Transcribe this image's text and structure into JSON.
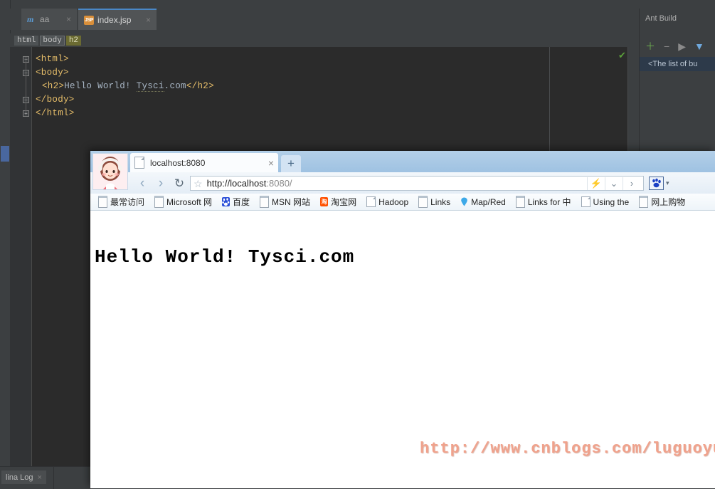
{
  "ide": {
    "tabs": [
      {
        "label": "aa",
        "icon": "maven-icon",
        "active": false,
        "close": "×"
      },
      {
        "label": "index.jsp",
        "icon": "jsp-file-icon",
        "active": true,
        "close": "×"
      }
    ],
    "breadcrumb": [
      "html",
      "body",
      "h2"
    ],
    "code_lines": [
      {
        "indent": 0,
        "fold": "minus",
        "html": "<span class='tag'>&lt;html&gt;</span>"
      },
      {
        "indent": 0,
        "fold": "minus",
        "html": "<span class='tag'>&lt;body&gt;</span>"
      },
      {
        "indent": 1,
        "fold": "none",
        "html": "<span class='tag'>&lt;h2&gt;</span><span class='txt'>Hello World! </span><span class='txt spell'>Tysci</span><span class='txt'>.com</span><span class='tag'>&lt;/h2&gt;</span>"
      },
      {
        "indent": 0,
        "fold": "plus",
        "html": "<span class='tag'>&lt;/body&gt;</span>"
      },
      {
        "indent": 0,
        "fold": "plus",
        "html": "<span class='tag'>&lt;/html&gt;</span>"
      }
    ],
    "code_plain": [
      "<html>",
      "<body>",
      "<h2>Hello World! Tysci.com</h2>",
      "</body>",
      "</html>"
    ],
    "inspection_status": "✔",
    "status_bar": {
      "log_tab_label": "lina Log",
      "log_tab_close": "×"
    }
  },
  "ant_build": {
    "title": "Ant Build",
    "toolbar": [
      {
        "name": "add-build-file-button",
        "glyph": "＋",
        "color": "#6aa84f"
      },
      {
        "name": "remove-build-file-button",
        "glyph": "−",
        "color": "#8a8a8a"
      },
      {
        "name": "run-build-button",
        "glyph": "▶",
        "color": "#8a8a8a"
      },
      {
        "name": "filter-targets-button",
        "glyph": "▼",
        "color": "#6fa8dc"
      }
    ],
    "empty_message": "<The list of bu"
  },
  "browser": {
    "tab": {
      "title": "localhost:8080",
      "close": "×"
    },
    "new_tab": "+",
    "nav": {
      "back": "‹",
      "forward": "›",
      "reload": "↻",
      "undo": "↺",
      "star": "☆",
      "lightning": "⚡",
      "chevron_down": "⌄",
      "chevron_right": "›",
      "ext_dropdown": "▾"
    },
    "url": {
      "scheme_host": "http://localhost",
      "port_path": ":8080/"
    },
    "bookmarks": [
      {
        "label": "最常访问",
        "icon": "folder"
      },
      {
        "label": "Microsoft 网",
        "icon": "folder"
      },
      {
        "label": "百度",
        "icon": "baidu"
      },
      {
        "label": "MSN 网站",
        "icon": "folder"
      },
      {
        "label": "淘宝网",
        "icon": "taobao"
      },
      {
        "label": "Hadoop",
        "icon": "page"
      },
      {
        "label": "Links",
        "icon": "folder"
      },
      {
        "label": "Map/Red",
        "icon": "pin"
      },
      {
        "label": "Links for 中",
        "icon": "folder"
      },
      {
        "label": "Using the",
        "icon": "page"
      },
      {
        "label": "网上购物",
        "icon": "folder"
      }
    ],
    "page": {
      "heading": "Hello World! Tysci.com",
      "watermark": "http://www.cnblogs.com/luguoyuanf"
    }
  }
}
